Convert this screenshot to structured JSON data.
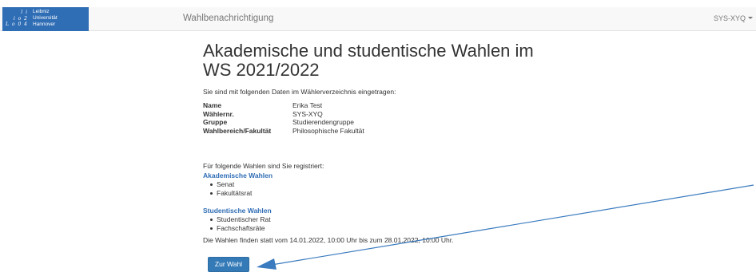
{
  "navbar": {
    "logo_lines": [
      "Leibniz",
      "Universität",
      "Hannover"
    ],
    "logo_mark": [
      "l  i",
      "i o 2",
      "L o 0 4"
    ],
    "title": "Wahlbenachrichtigung",
    "user_menu": "SYS-XYQ"
  },
  "main": {
    "heading_line1": "Akademische und studentische Wahlen im",
    "heading_line2": "WS 2021/2022",
    "intro": "Sie sind mit folgenden Daten im Wählerverzeichnis eingetragen:",
    "info": [
      {
        "label": "Name",
        "value": "Erika Test"
      },
      {
        "label": "Wählernr.",
        "value": "SYS-XYQ"
      },
      {
        "label": "Gruppe",
        "value": "Studierendengruppe"
      },
      {
        "label": "Wahlbereich/Fakultät",
        "value": "Philosophische Fakultät"
      }
    ],
    "registered_text": "Für folgende Wahlen sind Sie registriert:",
    "academic": {
      "heading": "Akademische Wahlen",
      "items": [
        "Senat",
        "Fakultätsrat"
      ]
    },
    "student": {
      "heading": "Studentische Wahlen",
      "items": [
        "Studentischer Rat",
        "Fachschaftsräte"
      ]
    },
    "dates_text": "Die Wahlen finden statt vom 14.01.2022, 10:00 Uhr bis zum 28.01.2022, 10:00 Uhr.",
    "button_label": "Zur Wahl"
  },
  "colors": {
    "brand_blue": "#2f6db5",
    "button_blue": "#337ab7",
    "annotation_arrow": "#3a7bbf"
  }
}
